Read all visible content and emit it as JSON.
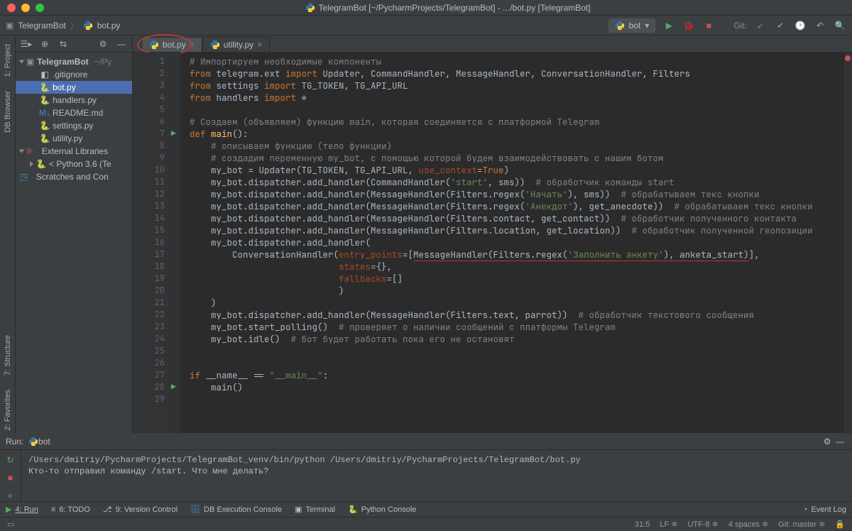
{
  "title": "TelegramBot [~/PycharmProjects/TelegramBot] - .../bot.py [TelegramBot]",
  "breadcrumb": {
    "root": "TelegramBot",
    "file": "bot.py"
  },
  "runConfig": "bot",
  "gitLabel": "Git:",
  "tabs": [
    {
      "name": "bot.py",
      "active": true
    },
    {
      "name": "utility.py",
      "active": false
    }
  ],
  "tree": {
    "root": "TelegramBot",
    "rootPath": "~/Py",
    "files": [
      ".gitignore",
      "bot.py",
      "handlers.py",
      "README.md",
      "settings.py",
      "utility.py"
    ],
    "extLib": "External Libraries",
    "python": "< Python 3.6 (Te",
    "scratch": "Scratches and Con"
  },
  "code": {
    "l1": "# Импортируем необходимые компоненты",
    "l2a": "from",
    "l2b": " telegram.ext ",
    "l2c": "import",
    "l2d": " Updater, CommandHandler, MessageHandler, ConversationHandler, Filters",
    "l3a": "from",
    "l3b": " settings ",
    "l3c": "import",
    "l3d": " TG_TOKEN, TG_API_URL",
    "l4a": "from",
    "l4b": " handlers ",
    "l4c": "import",
    "l4d": " *",
    "l6": "# Создаем (объявляем) функцию main, которая соединяется с платформой Telegram",
    "l7a": "def ",
    "l7b": "main",
    "l7c": "():",
    "l8": "    # описываем функцию (тело функции)",
    "l9": "    # создадим переменную my_bot, с помощью которой будем взаимодействовать с нашим ботом",
    "l10a": "    my_bot = Updater(TG_TOKEN, TG_API_URL, ",
    "l10p": "use_context",
    "l10b": "=",
    "l10c": "True",
    "l10d": ")",
    "l11a": "    my_bot.dispatcher.add_handler(CommandHandler(",
    "l11s": "'start'",
    "l11b": ", sms))  ",
    "l11c": "# обработчик команды start",
    "l12a": "    my_bot.dispatcher.add_handler(MessageHandler(Filters.regex(",
    "l12s": "'Начать'",
    "l12b": "), sms))  ",
    "l12c": "# обрабатываем текс кнопки",
    "l13a": "    my_bot.dispatcher.add_handler(MessageHandler(Filters.regex(",
    "l13s": "'Анекдот'",
    "l13b": "), get_anecdote))  ",
    "l13c": "# обрабатываем текс кнопки",
    "l14a": "    my_bot.dispatcher.add_handler(MessageHandler(Filters.contact, get_contact))  ",
    "l14c": "# обработчик полученного контакта",
    "l15a": "    my_bot.dispatcher.add_handler(MessageHandler(Filters.location, get_location))  ",
    "l15c": "# обработчик полученной геопозиции",
    "l16": "    my_bot.dispatcher.add_handler(",
    "l17a": "        ConversationHandler(",
    "l17p": "entry_points",
    "l17b": "=[",
    "l17u": "MessageHandler(Filters.regex(",
    "l17s": "'Заполнить анкету'",
    "l17d": "), anketa_start)",
    "l17e": "],",
    "l18p": "states",
    "l18b": "={},",
    "l19p": "fallbacks",
    "l19b": "=[]",
    "l20": "                            )",
    "l21": "    )",
    "l22a": "    my_bot.dispatcher.add_handler(MessageHandler(Filters.text, parrot))  ",
    "l22c": "# обработчик текстового сообщения",
    "l23a": "    my_bot.start_polling()  ",
    "l23c": "# проверяет о наличии сообщений с платформы Telegram",
    "l24a": "    my_bot.idle()  ",
    "l24c": "# бот будет работать пока его не остановят",
    "l27a": "if ",
    "l27b": "__name__",
    "l27c": " == ",
    "l27s": "\"__main__\"",
    "l27d": ":",
    "l28": "    main()"
  },
  "run": {
    "label": "Run:",
    "config": "bot",
    "line1": "/Users/dmitriy/PycharmProjects/TelegramBot_venv/bin/python /Users/dmitriy/PycharmProjects/TelegramBot/bot.py",
    "line2": "Кто-то отправил команду /start. Что мне делать?"
  },
  "tools": {
    "run": "4: Run",
    "todo": "6: TODO",
    "vcs": "9: Version Control",
    "db": "DB Execution Console",
    "terminal": "Terminal",
    "python": "Python Console",
    "eventlog": "Event Log"
  },
  "side": {
    "project": "1: Project",
    "dbbrowser": "DB Browser",
    "structure": "7: Structure",
    "favorites": "2: Favorites"
  },
  "status": {
    "pos": "31:5",
    "sep": "LF",
    "enc": "UTF-8",
    "indent": "4 spaces",
    "branch": "Git: master"
  }
}
